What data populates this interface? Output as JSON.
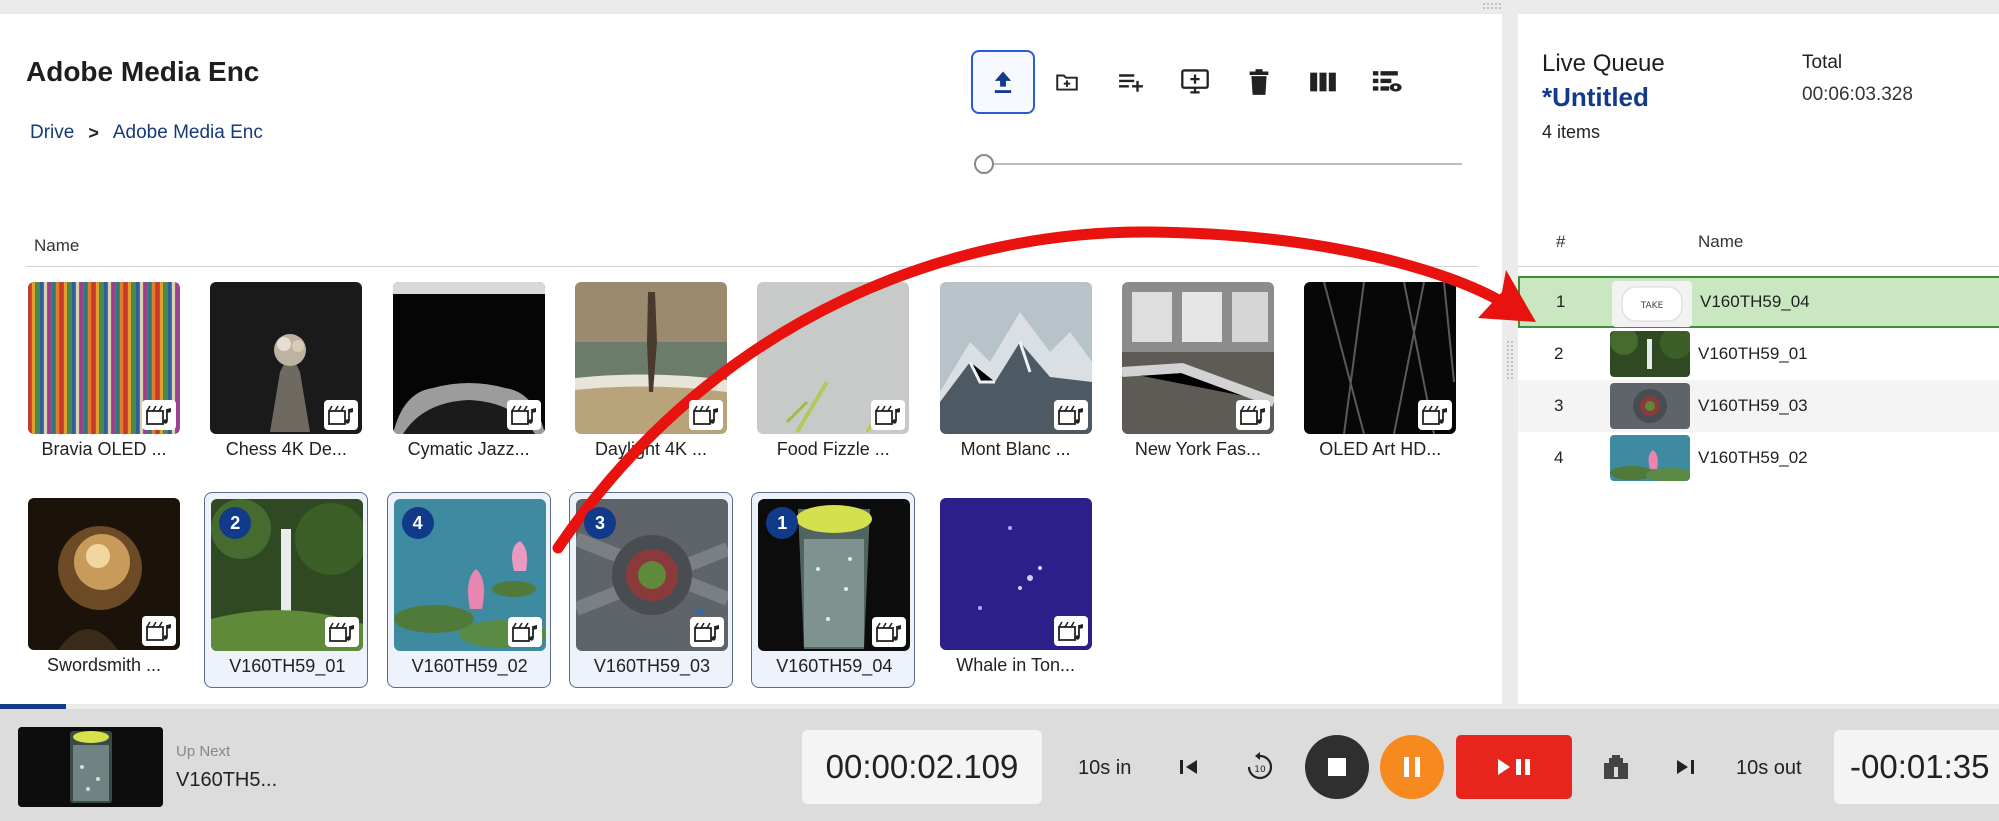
{
  "browser": {
    "folder_title": "Adobe Media Enc",
    "breadcrumb": [
      "Drive",
      "Adobe Media Enc"
    ],
    "column_header": "Name",
    "toolbar": [
      {
        "name": "upload-icon",
        "active": true
      },
      {
        "name": "new-folder-icon",
        "active": false
      },
      {
        "name": "add-to-queue-icon",
        "active": false
      },
      {
        "name": "add-to-screen-icon",
        "active": false
      },
      {
        "name": "trash-icon",
        "active": false
      },
      {
        "name": "grid-view-icon",
        "active": false
      },
      {
        "name": "list-preview-icon",
        "active": false
      }
    ],
    "tiles": [
      {
        "caption": "Bravia OLED ...",
        "selected": false,
        "badge": ""
      },
      {
        "caption": "Chess 4K De...",
        "selected": false,
        "badge": ""
      },
      {
        "caption": "Cymatic Jazz...",
        "selected": false,
        "badge": ""
      },
      {
        "caption": "Daylight 4K ...",
        "selected": false,
        "badge": ""
      },
      {
        "caption": "Food Fizzle ...",
        "selected": false,
        "badge": ""
      },
      {
        "caption": "Mont Blanc ...",
        "selected": false,
        "badge": ""
      },
      {
        "caption": "New York Fas...",
        "selected": false,
        "badge": ""
      },
      {
        "caption": "OLED Art HD...",
        "selected": false,
        "badge": ""
      },
      {
        "caption": "Swordsmith ...",
        "selected": false,
        "badge": ""
      },
      {
        "caption": "V160TH59_01",
        "selected": true,
        "badge": "2"
      },
      {
        "caption": "V160TH59_02",
        "selected": true,
        "badge": "4"
      },
      {
        "caption": "V160TH59_03",
        "selected": true,
        "badge": "3"
      },
      {
        "caption": "V160TH59_04",
        "selected": true,
        "badge": "1"
      },
      {
        "caption": "Whale in Ton...",
        "selected": false,
        "badge": ""
      }
    ]
  },
  "queue": {
    "label": "Live Queue",
    "name": "*Untitled",
    "count": "4 items",
    "total_label": "Total",
    "total_value": "00:06:03.328",
    "header_num": "#",
    "header_name": "Name",
    "rows": [
      {
        "num": "1",
        "name": "V160TH59_04",
        "live": true,
        "thumb_text": "TAKE"
      },
      {
        "num": "2",
        "name": "V160TH59_01",
        "live": false,
        "thumb_text": ""
      },
      {
        "num": "3",
        "name": "V160TH59_03",
        "live": false,
        "thumb_text": ""
      },
      {
        "num": "4",
        "name": "V160TH59_02",
        "live": false,
        "thumb_text": ""
      }
    ]
  },
  "transport": {
    "up_next_label": "Up Next",
    "up_next_name": "V160TH5...",
    "elapsed": "00:00:02.109",
    "in_label": "10s in",
    "out_label": "10s out",
    "remaining": "-00:01:35",
    "take_label": "▶II"
  },
  "colors": {
    "accent": "#123a8a",
    "live_row": "#c9e8c1",
    "take": "#e8251c",
    "pause": "#f68a1e",
    "arrow": "#e8130e"
  }
}
